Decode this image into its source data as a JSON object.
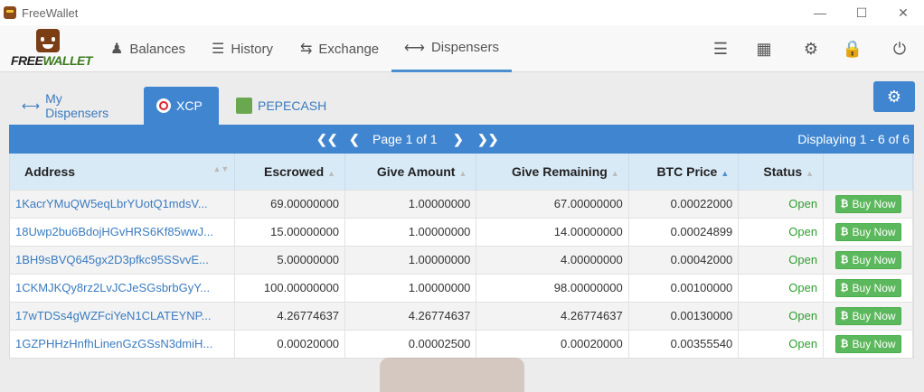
{
  "window": {
    "title": "FreeWallet"
  },
  "logo": {
    "text_free": "FREE",
    "text_wallet": "WALLET"
  },
  "nav": {
    "balances": "Balances",
    "history": "History",
    "exchange": "Exchange",
    "dispensers": "Dispensers"
  },
  "nav_icons": [
    "list-icon",
    "qrcode-icon",
    "gears-icon",
    "lock-icon",
    "power-icon"
  ],
  "tabs": {
    "my_dispensers": "My Dispensers",
    "xcp": "XCP",
    "pepecash": "PEPECASH"
  },
  "pager": {
    "page": "Page 1 of 1",
    "displaying": "Displaying 1 - 6 of 6"
  },
  "table": {
    "headers": [
      "Address",
      "Escrowed",
      "Give Amount",
      "Give Remaining",
      "BTC Price",
      "Status"
    ],
    "buy_label": "Buy Now",
    "rows": [
      [
        "1KacrYMuQW5eqLbrYUotQ1mdsV...",
        "69.00000000",
        "1.00000000",
        "67.00000000",
        "0.00022000",
        "Open"
      ],
      [
        "18Uwp2bu6BdojHGvHRS6Kf85wwJ...",
        "15.00000000",
        "1.00000000",
        "14.00000000",
        "0.00024899",
        "Open"
      ],
      [
        "1BH9sBVQ645gx2D3pfkc95SSvvE...",
        "5.00000000",
        "1.00000000",
        "4.00000000",
        "0.00042000",
        "Open"
      ],
      [
        "1CKMJKQy8rz2LvJCJeSGsbrbGyY...",
        "100.00000000",
        "1.00000000",
        "98.00000000",
        "0.00100000",
        "Open"
      ],
      [
        "17wTDSs4gWZFciYeN1CLATEYNP...",
        "4.26774637",
        "4.26774637",
        "4.26774637",
        "0.00130000",
        "Open"
      ],
      [
        "1GZPHHzHnfhLinenGzGSsN3dmiH...",
        "0.00020000",
        "0.00002500",
        "0.00020000",
        "0.00355540",
        "Open"
      ]
    ]
  },
  "colors": {
    "accent": "#3f85d0",
    "header_bg": "#d9eaf7",
    "open": "#2e9e2e",
    "buy": "#5cb85c"
  }
}
